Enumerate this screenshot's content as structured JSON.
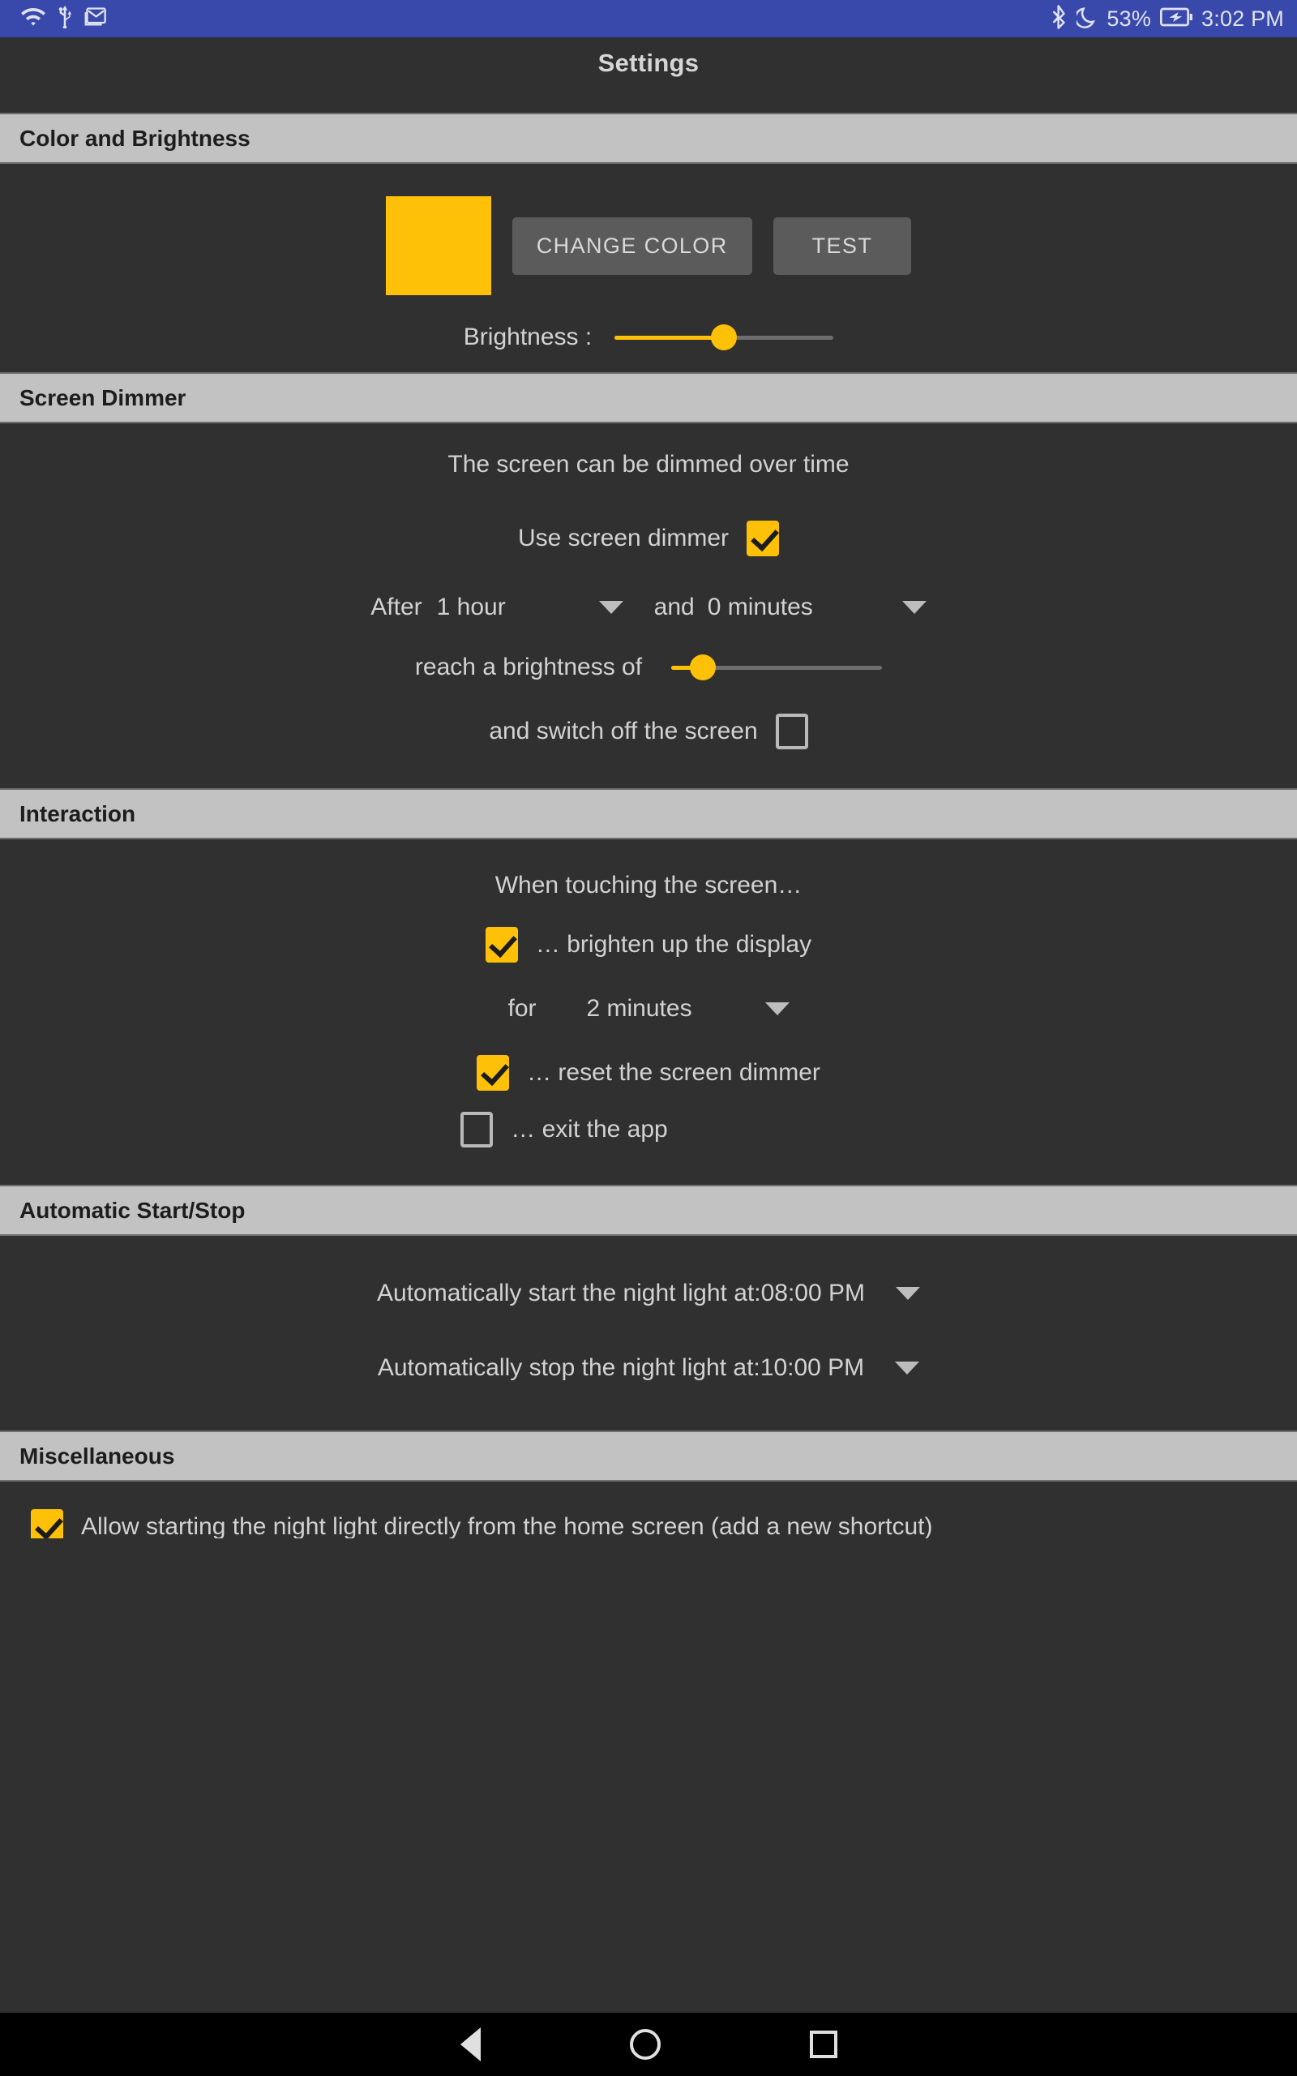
{
  "statusbar": {
    "left_icons": [
      "wifi-icon",
      "usb-icon",
      "gmail-icon"
    ],
    "bluetooth_icon": "bluetooth-icon",
    "dnd_icon": "moon-icon",
    "battery_percent": "53%",
    "battery_icon": "battery-charging-icon",
    "time": "3:02 PM",
    "background": "#3949ab"
  },
  "appbar": {
    "title": "Settings"
  },
  "sections": {
    "color_brightness": {
      "header": "Color and Brightness",
      "swatch_color": "#FFC107",
      "change_color_label": "CHANGE COLOR",
      "test_label": "TEST",
      "brightness_label": "Brightness :",
      "brightness_value": 50
    },
    "screen_dimmer": {
      "header": "Screen Dimmer",
      "description": "The screen can be dimmed over time",
      "use_dimmer_label": "Use screen dimmer",
      "use_dimmer_checked": true,
      "after_label": "After",
      "hours_value": "1 hour",
      "and_label": "and",
      "minutes_value": "0 minutes",
      "reach_brightness_label": "reach a brightness of",
      "reach_brightness_value": 15,
      "switch_off_label": "and switch off the screen",
      "switch_off_checked": false
    },
    "interaction": {
      "header": "Interaction",
      "intro": "When touching the screen…",
      "brighten_label": "… brighten up the display",
      "brighten_checked": true,
      "for_label": "for",
      "for_value": "2 minutes",
      "reset_label": "… reset the screen dimmer",
      "reset_checked": true,
      "exit_label": "… exit the app",
      "exit_checked": false
    },
    "auto_start_stop": {
      "header": "Automatic Start/Stop",
      "start_label": "Automatically start the night light at:08:00 PM",
      "stop_label": "Automatically stop the night light at:10:00 PM"
    },
    "miscellaneous": {
      "header": "Miscellaneous",
      "shortcut_label": "Allow starting the night light directly from the home screen (add a new shortcut)",
      "shortcut_checked": true
    }
  },
  "navbar": {
    "back": "back-icon",
    "home": "home-icon",
    "recents": "recents-icon"
  },
  "colors": {
    "accent": "#FFC107",
    "header_bg": "#c2c2c2",
    "body_bg": "#303030",
    "status_bg": "#3949ab"
  }
}
